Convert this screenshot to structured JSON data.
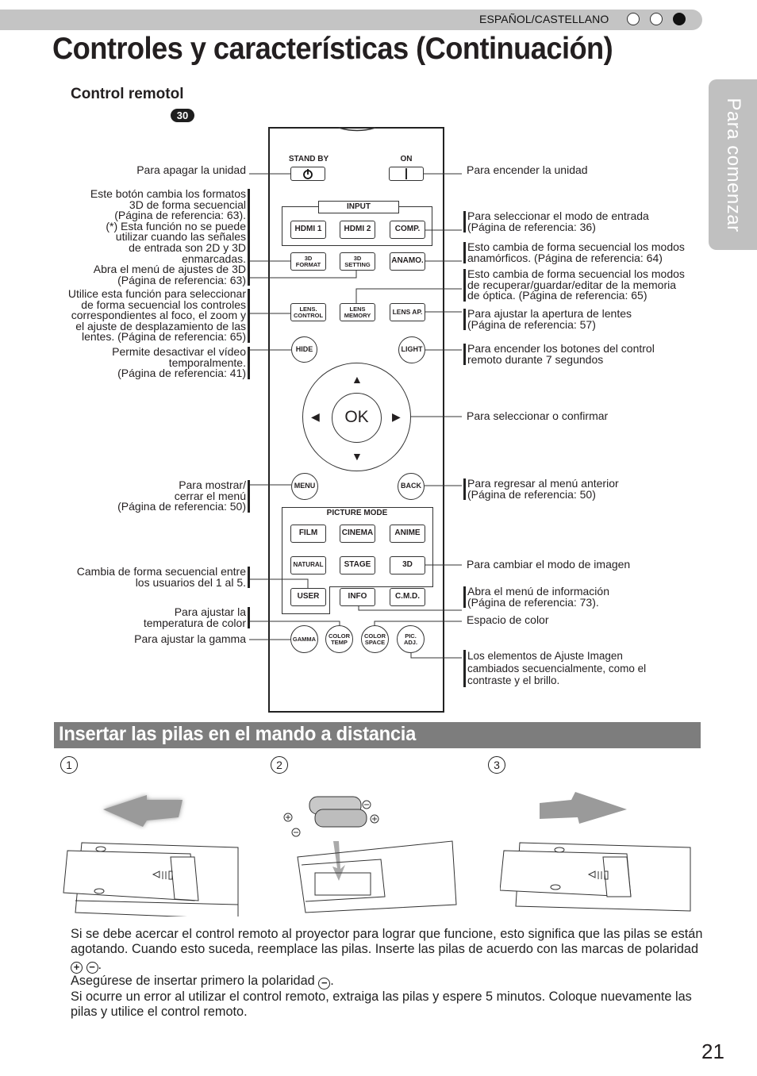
{
  "header": {
    "language": "ESPAÑOL/CASTELLANO",
    "progress_dots": [
      "empty",
      "empty",
      "filled"
    ],
    "title": "Controles y características (Continuación)",
    "side_tab": "Para comenzar"
  },
  "remote_section": {
    "subtitle": "Control remotol",
    "ref_badge": "30",
    "buttons": {
      "standby_label": "STAND BY",
      "on_label": "ON",
      "input_group": "INPUT",
      "hdmi1": "HDMI 1",
      "hdmi2": "HDMI 2",
      "comp": "COMP.",
      "format3d": [
        "3D",
        "FORMAT"
      ],
      "setting3d": [
        "3D",
        "SETTING"
      ],
      "anamo": "ANAMO.",
      "lens_control": [
        "LENS.",
        "CONTROL"
      ],
      "lens_memory": [
        "LENS",
        "MEMORY"
      ],
      "lens_ap": "LENS AP.",
      "hide": "HIDE",
      "light": "LIGHT",
      "ok": "OK",
      "menu": "MENU",
      "back": "BACK",
      "picture_mode_group": "PICTURE MODE",
      "film": "FILM",
      "cinema": "CINEMA",
      "anime": "ANIME",
      "natural": "NATURAL",
      "stage": "STAGE",
      "mode3d": "3D",
      "user": "USER",
      "info": "INFO",
      "cmd": "C.M.D.",
      "gamma": "GAMMA",
      "color_temp": [
        "COLOR",
        "TEMP"
      ],
      "color_space": [
        "COLOR",
        "SPACE"
      ],
      "pic_adj": [
        "PIC.",
        "ADJ."
      ]
    },
    "callouts_left": {
      "standby": "Para apagar la unidad",
      "format3d": "Este botón cambia los formatos\n3D de forma secuencial\n(Página de referencia: 63).\n(*) Esta función no se puede\nutilizar cuando las señales\nde entrada son 2D y 3D\nenmarcadas.",
      "setting3d": "Abra el menú de ajustes de 3D\n(Página de referencia: 63)",
      "lens_control": "Utilice esta función para seleccionar\nde forma secuencial los controles\ncorrespondientes al foco, el zoom y\nel ajuste de desplazamiento de las\nlentes. (Página de referencia: 65)",
      "hide": "Permite desactivar el vídeo\ntemporalmente.\n(Página de referencia: 41)",
      "menu": "Para mostrar/\ncerrar el menú\n(Página de referencia: 50)",
      "user": "Cambia de forma secuencial entre\nlos usuarios del 1 al 5.",
      "color_temp": "Para ajustar la\ntemperatura de color",
      "gamma": "Para ajustar la gamma"
    },
    "callouts_right": {
      "on": "Para encender la unidad",
      "input": "Para seleccionar el modo de entrada\n(Página de referencia: 36)",
      "anamo": "Esto cambia de forma secuencial los modos\nanamórficos. (Página de referencia: 64)",
      "lens_memory": "Esto cambia de forma secuencial los modos\nde recuperar/guardar/editar de la memoria\nde óptica. (Página de referencia: 65)",
      "lens_ap": "Para ajustar la apertura de lentes\n(Página de referencia: 57)",
      "light": "Para encender los botones del control\nremoto durante 7 segundos",
      "ok": "Para seleccionar o confirmar",
      "back": "Para regresar al menú anterior\n(Página de referencia: 50)",
      "picture_mode": "Para cambiar el modo de imagen",
      "info": "Abra el menú de información\n(Página de referencia: 73).",
      "color_space": "Espacio de color",
      "pic_adj": "Los elementos de Ajuste Imagen\ncambiados secuencialmente, como el\ncontraste y el brillo."
    }
  },
  "battery_section": {
    "title": "Insertar las pilas en el mando a distancia",
    "steps": [
      "1",
      "2",
      "3"
    ],
    "paragraph_1a": "Si se debe acercar el control remoto al proyector para lograr que funcione, esto significa que las pilas se están agotando. Cuando esto suceda, reemplace las pilas. Inserte las pilas de acuerdo con las marcas de polaridad",
    "paragraph_2": "Asegúrese de insertar primero la polaridad",
    "paragraph_3": "Si ocurre un error al utilizar el control remoto, extraiga las pilas y espere 5 minutos. Coloque nuevamente las pilas y utilice el control remoto.",
    "plus_symbol": "+",
    "minus_symbol": "−",
    "period": "."
  },
  "footer": {
    "page_number": "21"
  }
}
